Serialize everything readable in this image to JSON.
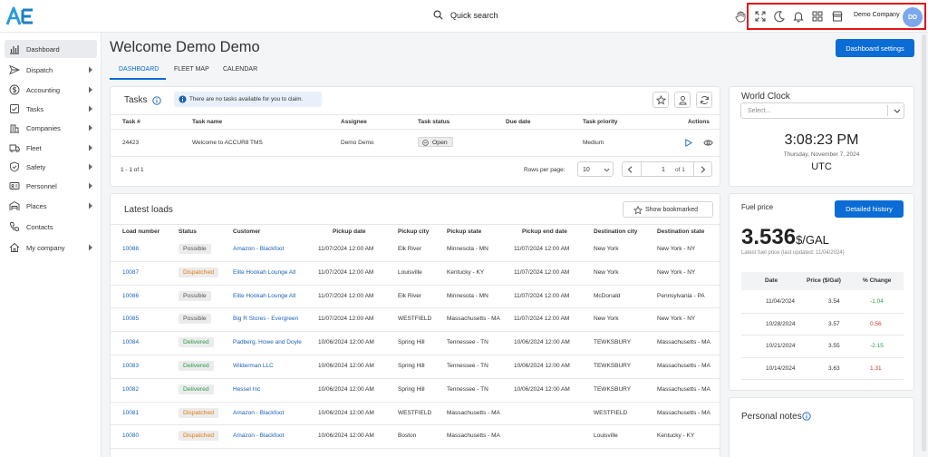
{
  "topbar": {
    "search_label": "Quick search",
    "company": "Demo Company",
    "avatar_initials": "DD",
    "icons": [
      "hand-icon",
      "fullscreen-icon",
      "moon-icon",
      "bell-icon",
      "apps-grid-icon",
      "store-icon"
    ],
    "highlight_color": "#e0151c"
  },
  "sidebar": {
    "items": [
      {
        "label": "Dashboard",
        "icon": "chart-bars-icon",
        "active": true,
        "has_children": false
      },
      {
        "label": "Dispatch",
        "icon": "send-icon",
        "has_children": true
      },
      {
        "label": "Accounting",
        "icon": "dollar-icon",
        "has_children": true
      },
      {
        "label": "Tasks",
        "icon": "tasks-icon",
        "has_children": true
      },
      {
        "label": "Companies",
        "icon": "building-icon",
        "has_children": true
      },
      {
        "label": "Fleet",
        "icon": "truck-icon",
        "has_children": true
      },
      {
        "label": "Safety",
        "icon": "shield-icon",
        "has_children": true
      },
      {
        "label": "Personnel",
        "icon": "id-card-icon",
        "has_children": true
      },
      {
        "label": "Places",
        "icon": "warehouse-icon",
        "has_children": true
      },
      {
        "label": "Contacts",
        "icon": "phone-icon",
        "has_children": false
      },
      {
        "label": "My company",
        "icon": "home-icon",
        "has_children": true
      }
    ]
  },
  "page": {
    "title": "Welcome Demo Demo",
    "settings_button": "Dashboard settings",
    "tabs": [
      "DASHBOARD",
      "FLEET MAP",
      "CALENDAR"
    ]
  },
  "tasks": {
    "title": "Tasks",
    "info": "There are no tasks available for you to claim.",
    "columns": [
      "Task #",
      "Task name",
      "Assignee",
      "Task status",
      "Due date",
      "Task priority",
      "Actions"
    ],
    "rows": [
      {
        "num": "24423",
        "name": "Welcome to ACCUR8 TMS",
        "assignee": "Demo Demo",
        "status": "Open",
        "due": "",
        "priority": "Medium"
      }
    ],
    "range": "1 - 1 of 1",
    "rows_per_page_label": "Rows per page:",
    "rows_per_page": "10",
    "page": "1",
    "of_pages": "of 1"
  },
  "loads": {
    "title": "Latest loads",
    "bookmark_button": "Show bookmarked",
    "columns": [
      "Load number",
      "Status",
      "Customer",
      "Pickup date",
      "Pickup city",
      "Pickup state",
      "Pickup end date",
      "Destination city",
      "Destination state"
    ],
    "rows": [
      {
        "num": "10088",
        "status": "Possible",
        "customer": "Amazon - Blackfoot",
        "pdate": "11/07/2024 12:00 AM",
        "pcity": "Elk River",
        "pstate": "Minnesota - MN",
        "pend": "11/07/2024 12:00 AM",
        "dcity": "New York",
        "dstate": "New York - NY"
      },
      {
        "num": "10087",
        "status": "Dispatched",
        "customer": "Elite Hookah Lounge Atl",
        "pdate": "11/07/2024 12:00 AM",
        "pcity": "Louisville",
        "pstate": "Kentucky - KY",
        "pend": "11/07/2024 12:00 AM",
        "dcity": "New York",
        "dstate": "New York - NY"
      },
      {
        "num": "10086",
        "status": "Possible",
        "customer": "Elite Hookah Lounge Atl",
        "pdate": "11/07/2024 12:00 AM",
        "pcity": "Elk River",
        "pstate": "Minnesota - MN",
        "pend": "11/07/2024 12:00 AM",
        "dcity": "McDonald",
        "dstate": "Pennsylvania - PA"
      },
      {
        "num": "10085",
        "status": "Possible",
        "customer": "Big R Stores - Evergreen",
        "pdate": "11/07/2024 12:00 AM",
        "pcity": "WESTFIELD",
        "pstate": "Massachusetts - MA",
        "pend": "11/07/2024 12:00 AM",
        "dcity": "New York",
        "dstate": "New York - NY"
      },
      {
        "num": "10084",
        "status": "Delivered",
        "customer": "Padberg, Howe and Doyle",
        "pdate": "10/06/2024 12:00 AM",
        "pcity": "Spring Hill",
        "pstate": "Tennessee - TN",
        "pend": "10/06/2024 12:00 AM",
        "dcity": "TEWKSBURY",
        "dstate": "Massachusetts - MA"
      },
      {
        "num": "10083",
        "status": "Delivered",
        "customer": "Wilderman LLC",
        "pdate": "10/06/2024 12:00 AM",
        "pcity": "Spring Hill",
        "pstate": "Tennessee - TN",
        "pend": "10/06/2024 12:00 AM",
        "dcity": "TEWKSBURY",
        "dstate": "Massachusetts - MA"
      },
      {
        "num": "10082",
        "status": "Delivered",
        "customer": "Hessel Inc",
        "pdate": "10/06/2024 12:00 AM",
        "pcity": "Spring Hill",
        "pstate": "Tennessee - TN",
        "pend": "10/06/2024 12:00 AM",
        "dcity": "TEWKSBURY",
        "dstate": "Massachusetts - MA"
      },
      {
        "num": "10081",
        "status": "Dispatched",
        "customer": "Amazon - Blackfoot",
        "pdate": "10/06/2024 12:00 AM",
        "pcity": "WESTFIELD",
        "pstate": "Massachusetts - MA",
        "pend": "",
        "dcity": "WESTFIELD",
        "dstate": "Massachusetts - MA"
      },
      {
        "num": "10080",
        "status": "Dispatched",
        "customer": "Amazon - Blackfoot",
        "pdate": "10/06/2024 12:00 AM",
        "pcity": "Boston",
        "pstate": "Massachusetts - MA",
        "pend": "",
        "dcity": "Louisville",
        "dstate": "Kentucky - KY"
      }
    ],
    "status_colors": {
      "Possible": "#555555",
      "Dispatched": "#e07a12",
      "Delivered": "#2a9d4a"
    }
  },
  "clock": {
    "title": "World Clock",
    "select_placeholder": "Select...",
    "time": "3:08:23 PM",
    "date": "Thursday, November 7, 2024",
    "zone": "UTC"
  },
  "fuel": {
    "title": "Fuel price",
    "history_button": "Detailed history",
    "price": "3.536",
    "unit": "$/GAL",
    "last_updated": "Latest fuel price (last updated: 11/04/2024)",
    "columns": [
      "Date",
      "Price ($/Gal)",
      "% Change"
    ],
    "rows": [
      {
        "date": "11/04/2024",
        "price": "3.54",
        "change": "-1.04",
        "trend": "down"
      },
      {
        "date": "10/28/2024",
        "price": "3.57",
        "change": "0.56",
        "trend": "up"
      },
      {
        "date": "10/21/2024",
        "price": "3.55",
        "change": "-2.15",
        "trend": "down"
      },
      {
        "date": "10/14/2024",
        "price": "3.63",
        "change": "1.31",
        "trend": "up"
      }
    ]
  },
  "notes": {
    "title": "Personal notes"
  },
  "colors": {
    "accent": "#0a6cd4",
    "positive": "#2a9d4a",
    "negative": "#d8342c"
  }
}
